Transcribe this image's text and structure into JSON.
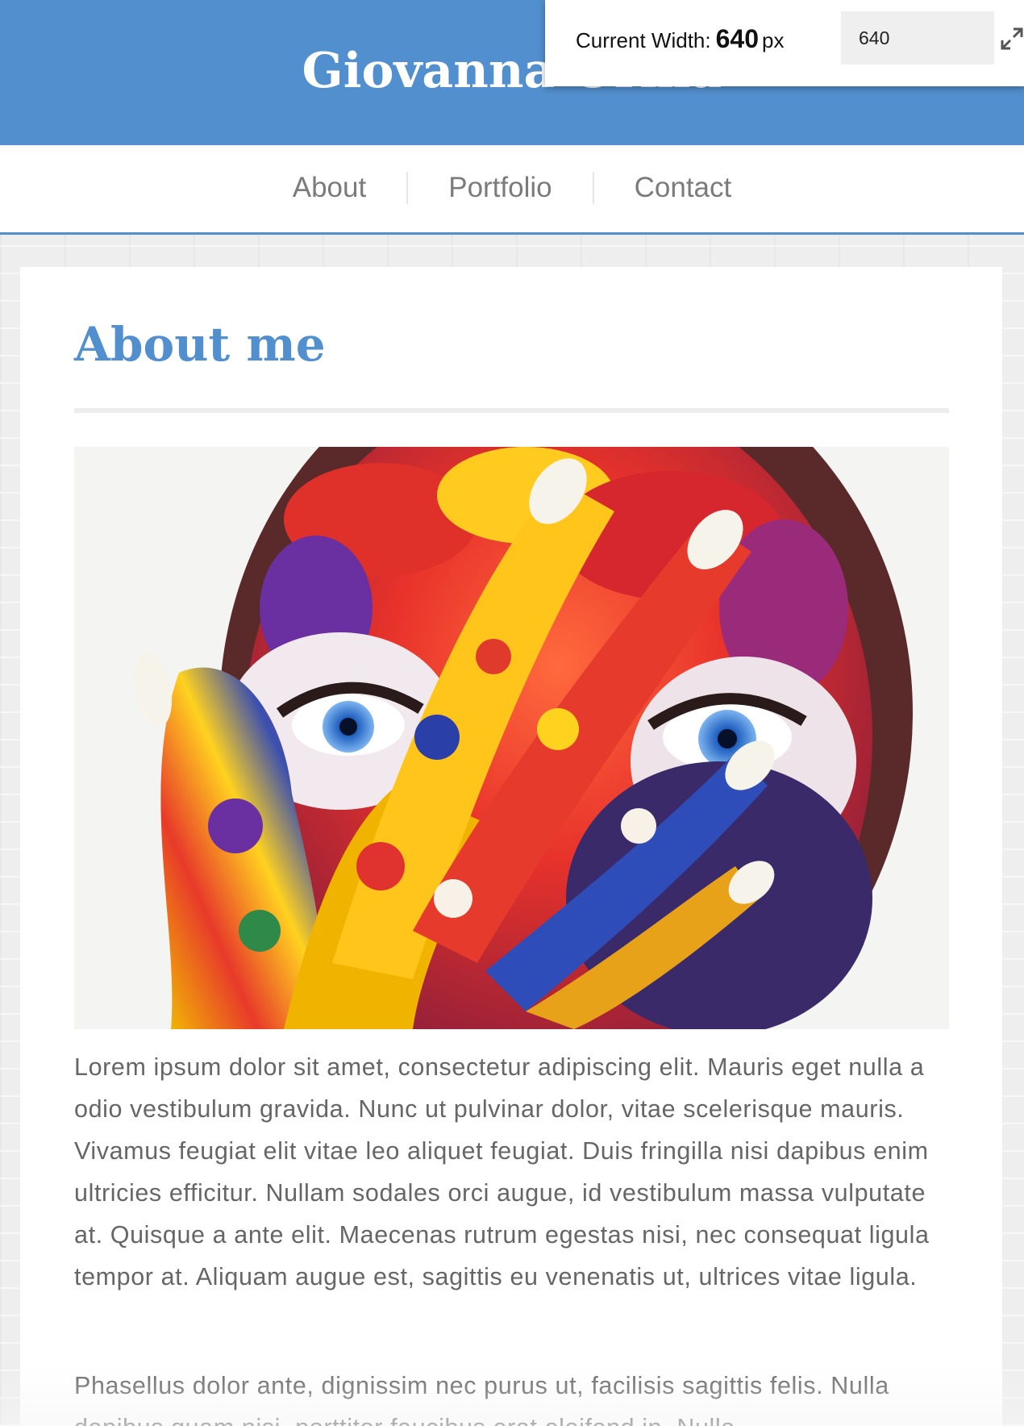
{
  "header": {
    "title": "Giovanna Orma"
  },
  "nav": {
    "items": [
      "About",
      "Portfolio",
      "Contact"
    ]
  },
  "main": {
    "heading": "About me",
    "image_alt": "colorful painted face and hand",
    "paragraphs": [
      "Lorem ipsum dolor sit amet, consectetur adipiscing elit. Mauris eget nulla a odio vestibulum gravida. Nunc ut pulvinar dolor, vitae scelerisque mauris. Vivamus feugiat elit vitae leo aliquet feugiat. Duis fringilla nisi dapibus enim ultricies efficitur. Nullam sodales orci augue, id vestibulum massa vulputate at. Quisque a ante elit. Maecenas rutrum egestas nisi, nec consequat ligula tempor at. Aliquam augue est, sagittis eu venenatis ut, ultrices vitae ligula.",
      "Phasellus dolor ante, dignissim nec purus ut, facilisis sagittis felis. Nulla dapibus quam nisi, porttitor faucibus erat eleifend in. Nulla"
    ]
  },
  "width_tool": {
    "label": "Current Width:",
    "value": "640",
    "unit": "px",
    "input_value": "640",
    "expand_icon": "expand-arrows-icon"
  },
  "colors": {
    "brand_blue": "#528fce",
    "nav_text": "#7b7b7b",
    "body_text": "#666666"
  }
}
